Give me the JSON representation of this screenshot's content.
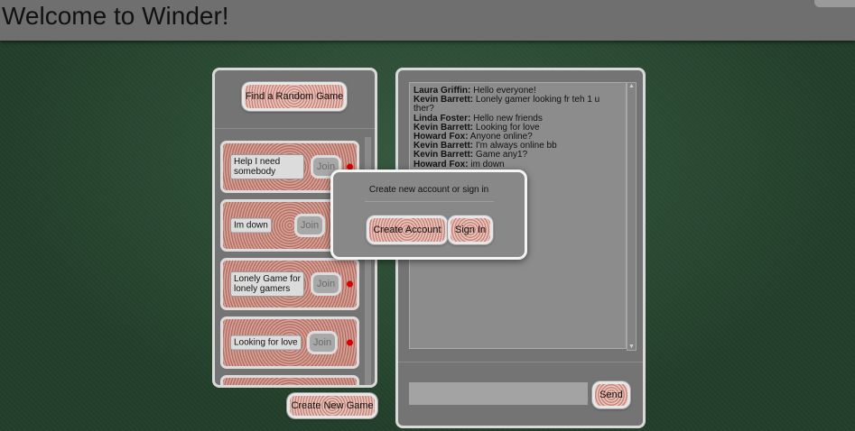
{
  "header": {
    "title": "Welcome to Winder!"
  },
  "lobby": {
    "random_game_label": "Find a Random Game",
    "create_game_label": "Create New Game",
    "games": [
      {
        "name": "Help I need somebody",
        "join_label": "Join",
        "status": "red"
      },
      {
        "name": "Im down",
        "join_label": "Join",
        "status": ""
      },
      {
        "name": "Lonely Game for lonely gamers",
        "join_label": "Join",
        "status": "red"
      },
      {
        "name": "Looking for love",
        "join_label": "Join",
        "status": "red"
      }
    ]
  },
  "chat": {
    "messages": [
      {
        "user": "Laura Griffin:",
        "text": " Hello everyone!"
      },
      {
        "user": "Kevin Barrett:",
        "text": " Lonely gamer looking fr teh 1 u ther?"
      },
      {
        "user": "Linda Foster:",
        "text": " Hello new friends"
      },
      {
        "user": "Kevin Barrett:",
        "text": " Looking for love"
      },
      {
        "user": "Howard Fox:",
        "text": " Anyone online?"
      },
      {
        "user": "Kevin Barrett:",
        "text": " I'm always online bb"
      },
      {
        "user": "Kevin Barrett:",
        "text": " Game any1?"
      },
      {
        "user": "Howard Fox:",
        "text": " im down"
      }
    ],
    "input_value": "",
    "send_label": "Send"
  },
  "modal": {
    "message": "Create new account or sign in",
    "create_account_label": "Create Account",
    "sign_in_label": "Sign In"
  },
  "colors": {
    "background": "#233f2b",
    "status_dot": "#d40000"
  }
}
